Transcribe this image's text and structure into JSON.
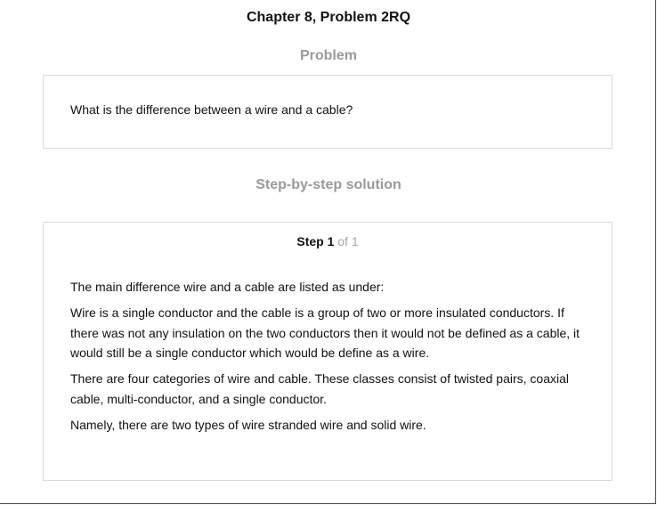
{
  "header": {
    "title": "Chapter 8, Problem 2RQ"
  },
  "problem": {
    "heading": "Problem",
    "text": "What is the difference between a wire and a cable?"
  },
  "solution": {
    "heading": "Step-by-step solution",
    "step": {
      "label": "Step 1",
      "of": " of 1"
    },
    "paragraphs": [
      "The main difference wire and a cable are listed as under:",
      "Wire is a single conductor and the cable is a group of two or more insulated conductors. If there was not any insulation on the two conductors then it would not be defined as a cable, it would still be a single conductor which would be define as a wire.",
      "There are four categories of wire and cable. These classes consist of twisted pairs, coaxial cable, multi-conductor, and a single conductor.",
      "Namely, there are two types of wire stranded wire and solid wire."
    ]
  }
}
